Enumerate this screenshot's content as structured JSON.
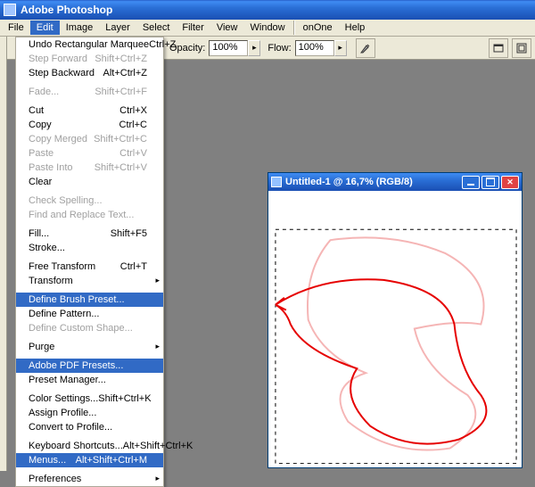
{
  "app": {
    "title": "Adobe Photoshop"
  },
  "menubar": {
    "items": [
      "File",
      "Edit",
      "Image",
      "Layer",
      "Select",
      "Filter",
      "View",
      "Window",
      "onOne",
      "Help"
    ]
  },
  "options": {
    "opacity_label": "Opacity:",
    "opacity_value": "100%",
    "flow_label": "Flow:",
    "flow_value": "100%"
  },
  "edit_menu": [
    {
      "label": "Undo Rectangular Marquee",
      "shortcut": "Ctrl+Z",
      "enabled": true
    },
    {
      "label": "Step Forward",
      "shortcut": "Shift+Ctrl+Z",
      "enabled": false
    },
    {
      "label": "Step Backward",
      "shortcut": "Alt+Ctrl+Z",
      "enabled": true
    },
    {
      "sep": true
    },
    {
      "label": "Fade...",
      "shortcut": "Shift+Ctrl+F",
      "enabled": false
    },
    {
      "sep": true
    },
    {
      "label": "Cut",
      "shortcut": "Ctrl+X",
      "enabled": true
    },
    {
      "label": "Copy",
      "shortcut": "Ctrl+C",
      "enabled": true
    },
    {
      "label": "Copy Merged",
      "shortcut": "Shift+Ctrl+C",
      "enabled": false
    },
    {
      "label": "Paste",
      "shortcut": "Ctrl+V",
      "enabled": false
    },
    {
      "label": "Paste Into",
      "shortcut": "Shift+Ctrl+V",
      "enabled": false
    },
    {
      "label": "Clear",
      "shortcut": "",
      "enabled": true
    },
    {
      "sep": true
    },
    {
      "label": "Check Spelling...",
      "shortcut": "",
      "enabled": false
    },
    {
      "label": "Find and Replace Text...",
      "shortcut": "",
      "enabled": false
    },
    {
      "sep": true
    },
    {
      "label": "Fill...",
      "shortcut": "Shift+F5",
      "enabled": true
    },
    {
      "label": "Stroke...",
      "shortcut": "",
      "enabled": true
    },
    {
      "sep": true
    },
    {
      "label": "Free Transform",
      "shortcut": "Ctrl+T",
      "enabled": true
    },
    {
      "label": "Transform",
      "shortcut": "",
      "enabled": true,
      "submenu": true
    },
    {
      "sep": true
    },
    {
      "label": "Define Brush Preset...",
      "shortcut": "",
      "enabled": true,
      "highlight": true
    },
    {
      "label": "Define Pattern...",
      "shortcut": "",
      "enabled": true
    },
    {
      "label": "Define Custom Shape...",
      "shortcut": "",
      "enabled": false
    },
    {
      "sep": true
    },
    {
      "label": "Purge",
      "shortcut": "",
      "enabled": true,
      "submenu": true
    },
    {
      "sep": true
    },
    {
      "label": "Adobe PDF Presets...",
      "shortcut": "",
      "enabled": true,
      "highlight": true
    },
    {
      "label": "Preset Manager...",
      "shortcut": "",
      "enabled": true
    },
    {
      "sep": true
    },
    {
      "label": "Color Settings...",
      "shortcut": "Shift+Ctrl+K",
      "enabled": true
    },
    {
      "label": "Assign Profile...",
      "shortcut": "",
      "enabled": true
    },
    {
      "label": "Convert to Profile...",
      "shortcut": "",
      "enabled": true
    },
    {
      "sep": true
    },
    {
      "label": "Keyboard Shortcuts...",
      "shortcut": "Alt+Shift+Ctrl+K",
      "enabled": true
    },
    {
      "label": "Menus...",
      "shortcut": "Alt+Shift+Ctrl+M",
      "enabled": true,
      "highlight": true
    },
    {
      "sep": true
    },
    {
      "label": "Preferences",
      "shortcut": "",
      "enabled": true,
      "submenu": true
    }
  ],
  "document": {
    "title": "Untitled-1 @ 16,7% (RGB/8)"
  }
}
